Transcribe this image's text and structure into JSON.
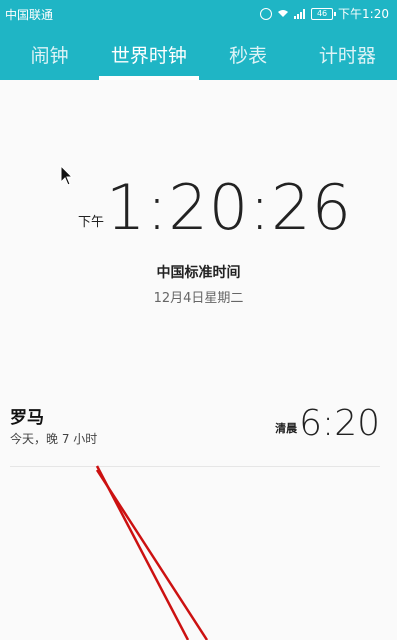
{
  "status_bar": {
    "carrier": "中国联通",
    "battery": "46",
    "time": "下午1:20",
    "icons": [
      "alarm-icon",
      "wifi-icon",
      "signal-icon",
      "battery-icon"
    ]
  },
  "tabs": [
    {
      "label": "闹钟"
    },
    {
      "label": "世界时钟"
    },
    {
      "label": "秒表"
    },
    {
      "label": "计时器"
    }
  ],
  "active_tab_index": 1,
  "local_clock": {
    "ampm": "下午",
    "time": "1:20:26",
    "timezone": "中国标准时间",
    "date": "12月4日星期二"
  },
  "cities": [
    {
      "name": "罗马",
      "offset": "今天，晚 7 小时",
      "ampm": "清晨",
      "time": "6:20"
    }
  ],
  "colors": {
    "accent": "#1fb5c5",
    "annotation": "#cc1111"
  }
}
